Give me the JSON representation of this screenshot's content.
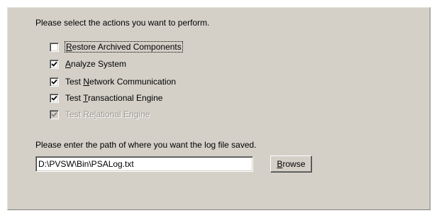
{
  "options_prompt": "Please select the actions you want to perform.",
  "options": [
    {
      "label_pre": "",
      "mnemonic": "R",
      "label_post": "estore Archived Components",
      "checked": false,
      "disabled": false,
      "focused": true
    },
    {
      "label_pre": "",
      "mnemonic": "A",
      "label_post": "nalyze System",
      "checked": true,
      "disabled": false,
      "focused": false
    },
    {
      "label_pre": "Test ",
      "mnemonic": "N",
      "label_post": "etwork Communication",
      "checked": true,
      "disabled": false,
      "focused": false
    },
    {
      "label_pre": "Test ",
      "mnemonic": "T",
      "label_post": "ransactional Engine",
      "checked": true,
      "disabled": false,
      "focused": false
    },
    {
      "label_pre": "Test Re",
      "mnemonic": "l",
      "label_post": "ational Engine",
      "checked": true,
      "disabled": true,
      "focused": false
    }
  ],
  "log_prompt": "Please enter the path of where you want the log file saved.",
  "log_path_value": "D:\\PVSW\\Bin\\PSALog.txt",
  "browse_button": {
    "mnemonic": "B",
    "rest": "rowse"
  },
  "colors": {
    "panel": "#d4d0c8",
    "disabled_text": "#9b9891"
  }
}
